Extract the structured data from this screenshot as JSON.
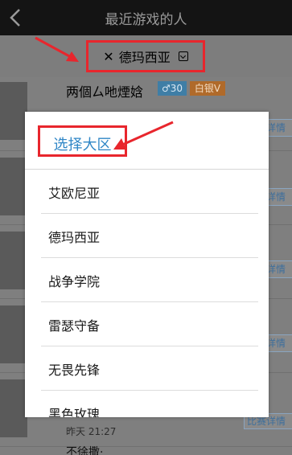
{
  "header": {
    "title": "最近游戏的人",
    "back_icon": "chevron-left-icon"
  },
  "region_selector": {
    "close_icon": "close-icon",
    "current_region": "德玛西亚",
    "dropdown_icon": "dropdown-square-icon"
  },
  "background_list": {
    "player_name": "两個ㄙ吔煙娢",
    "level_badge": "♂30",
    "rank_badge": "白银V",
    "detail_label": "详情",
    "detail_bottom_label": "比赛详情",
    "timestamp": "昨天 21:27",
    "next_player_name": "不徐撒·"
  },
  "dialog": {
    "title": "选择大区",
    "options": [
      {
        "label": "艾欧尼亚"
      },
      {
        "label": "德玛西亚"
      },
      {
        "label": "战争学院"
      },
      {
        "label": "雷瑟守备"
      },
      {
        "label": "无畏先锋"
      },
      {
        "label": "黑色玫瑰"
      }
    ]
  },
  "colors": {
    "highlight_box": "#e8262d",
    "dialog_title": "#2f86c6",
    "topbar": "#141414"
  }
}
